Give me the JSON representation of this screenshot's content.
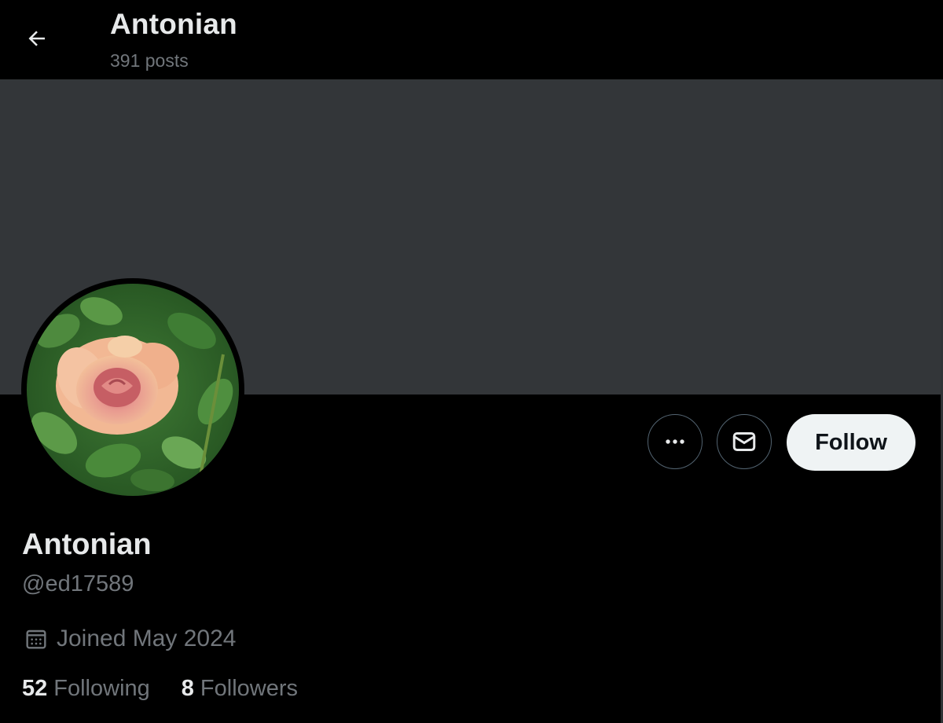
{
  "header": {
    "title": "Antonian",
    "posts_count": "391 posts",
    "back_icon": "arrow-left-icon"
  },
  "banner": {
    "color": "#333639"
  },
  "avatar": {
    "description_icon": "rose-avatar"
  },
  "actions": {
    "more_icon": "more-horizontal-icon",
    "message_icon": "envelope-icon",
    "follow_label": "Follow"
  },
  "profile": {
    "display_name": "Antonian",
    "handle": "@ed17589",
    "joined_icon": "calendar-icon",
    "joined": "Joined May 2024",
    "following_count": "52",
    "following_label": "Following",
    "followers_count": "8",
    "followers_label": "Followers"
  },
  "colors": {
    "background": "#000000",
    "primary_text": "#e7e9ea",
    "secondary_text": "#71767b",
    "follow_button_bg": "#eff3f4",
    "follow_button_text": "#0f1419",
    "border": "#536471"
  }
}
